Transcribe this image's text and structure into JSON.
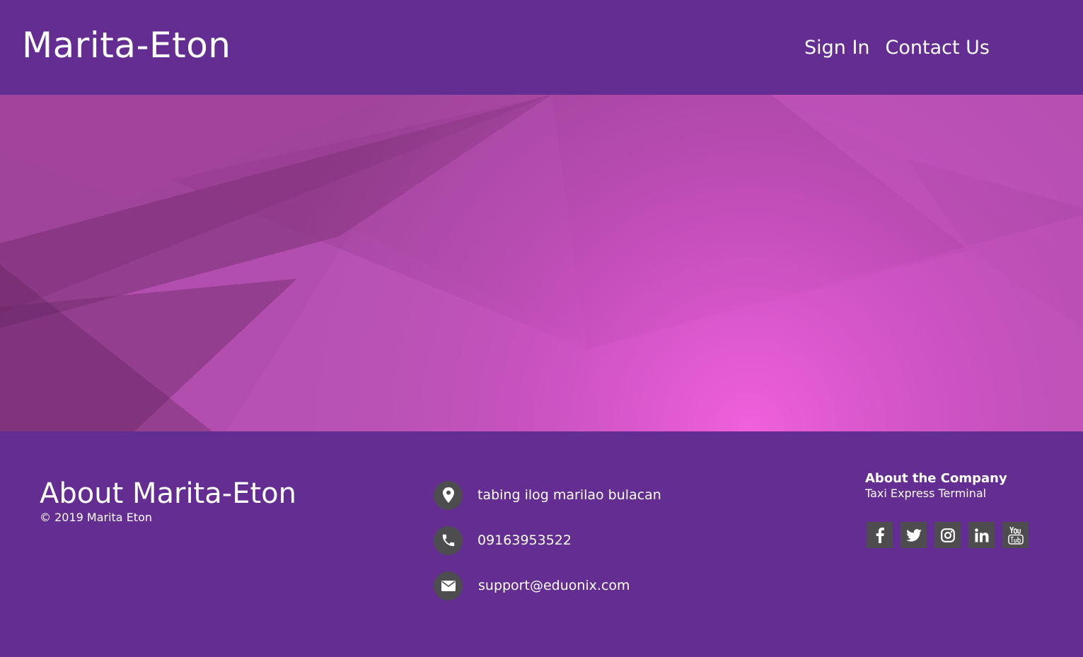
{
  "header": {
    "brand": "Marita-Eton",
    "nav": [
      {
        "label": "Sign In"
      },
      {
        "label": "Contact Us"
      }
    ]
  },
  "hero": {
    "colors": {
      "base": "#b24fae",
      "dark": "#6e2a6a",
      "glow": "#f060dc"
    }
  },
  "footer": {
    "about": {
      "title": "About Marita-Eton",
      "copyright": "© 2019 Marita Eton"
    },
    "contacts": [
      {
        "icon": "map-marker-icon",
        "text": "tabing ilog marilao bulacan"
      },
      {
        "icon": "phone-icon",
        "text": "09163953522"
      },
      {
        "icon": "envelope-icon",
        "text": "support@eduonix.com"
      }
    ],
    "company": {
      "title": "About the Company",
      "subtitle": "Taxi Express Terminal"
    },
    "social": [
      {
        "icon": "facebook-icon"
      },
      {
        "icon": "twitter-icon"
      },
      {
        "icon": "instagram-icon"
      },
      {
        "icon": "linkedin-icon"
      },
      {
        "icon": "youtube-icon"
      }
    ]
  },
  "colors": {
    "primary": "#632d91",
    "icon_bg": "#4d4d4f",
    "text": "#ffffff"
  }
}
